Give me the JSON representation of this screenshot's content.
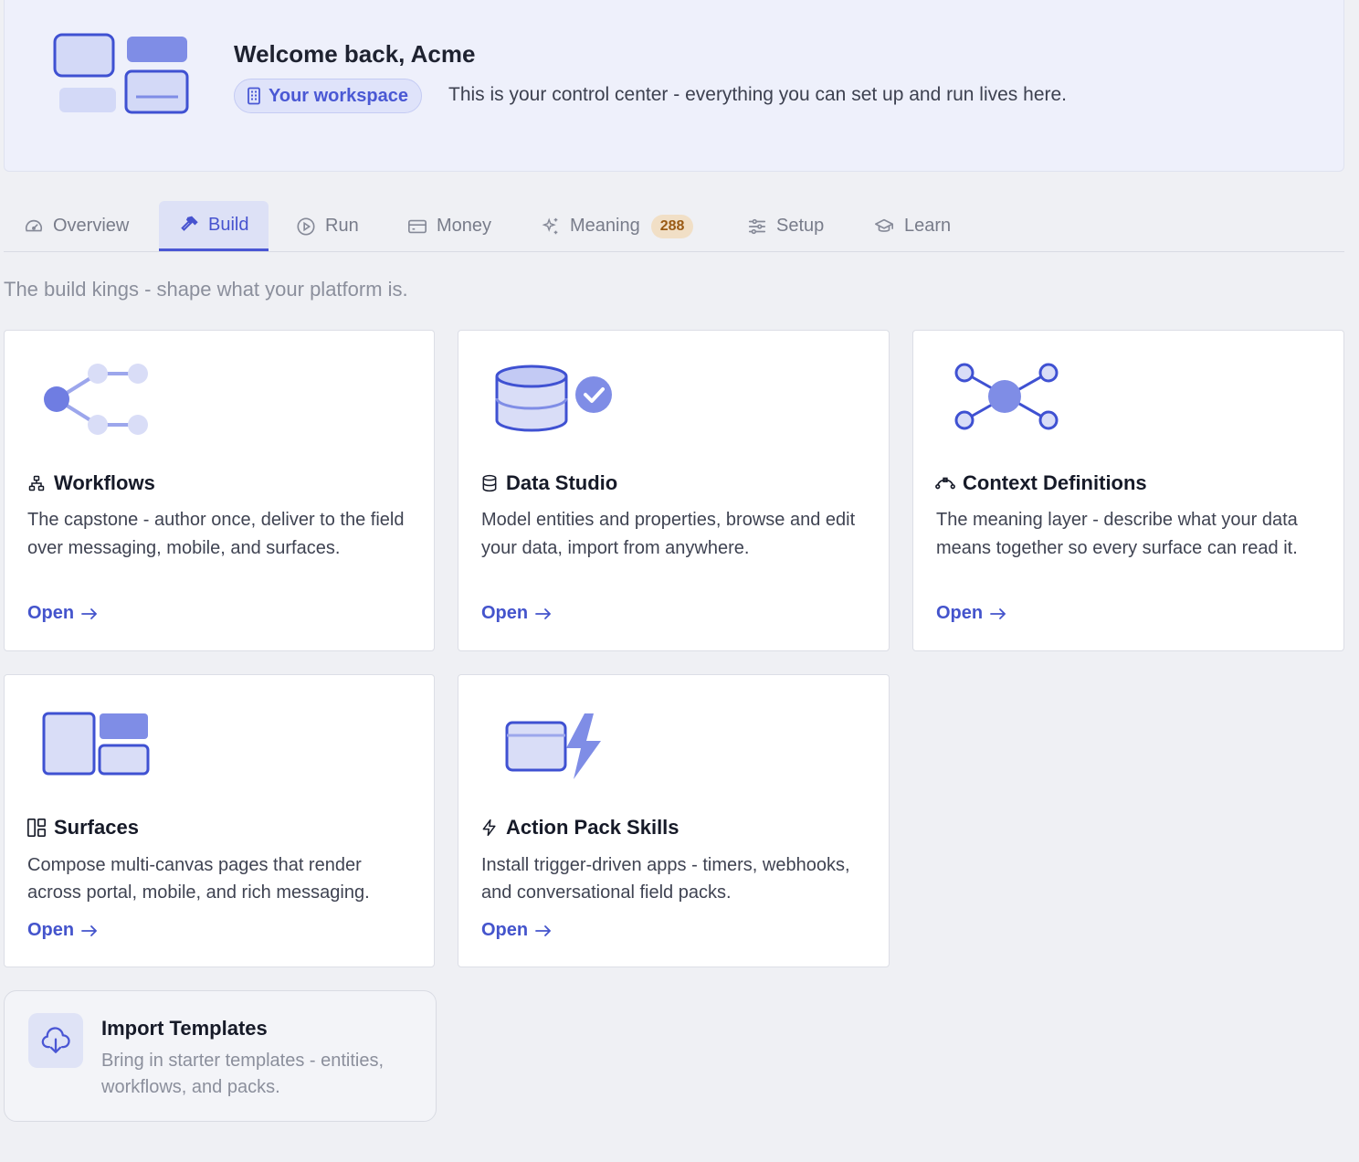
{
  "hero": {
    "title": "Welcome back, Acme",
    "workspace_pill": "Your workspace",
    "subtitle": "This is your control center - everything you can set up and run lives here."
  },
  "tabs": [
    {
      "label": "Overview",
      "icon": "gauge-icon",
      "active": false
    },
    {
      "label": "Build",
      "icon": "hammer-icon",
      "active": true
    },
    {
      "label": "Run",
      "icon": "play-circle-icon",
      "active": false
    },
    {
      "label": "Money",
      "icon": "credit-card-icon",
      "active": false
    },
    {
      "label": "Meaning",
      "icon": "sparkles-icon",
      "active": false,
      "badge": "288"
    },
    {
      "label": "Setup",
      "icon": "sliders-icon",
      "active": false
    },
    {
      "label": "Learn",
      "icon": "graduation-cap-icon",
      "active": false
    }
  ],
  "lede": "The build kings - shape what your platform is.",
  "cards": [
    {
      "title": "Workflows",
      "icon": "workflow-icon",
      "description": "The capstone - author once, deliver to the field over messaging, mobile, and surfaces.",
      "link": "Open"
    },
    {
      "title": "Data Studio",
      "icon": "database-icon",
      "description": "Model entities and properties, browse and edit your data, import from anywhere.",
      "link": "Open"
    },
    {
      "title": "Context Definitions",
      "icon": "spline-icon",
      "description": "The meaning layer - describe what your data means together so every surface can read it.",
      "link": "Open"
    },
    {
      "title": "Surfaces",
      "icon": "layout-panels-icon",
      "description": "Compose multi-canvas pages that render across portal, mobile, and rich messaging.",
      "link": "Open"
    },
    {
      "title": "Action Pack Skills",
      "icon": "zap-icon",
      "description": "Install trigger-driven apps - timers, webhooks, and conversational field packs.",
      "link": "Open"
    }
  ],
  "import": {
    "title": "Import Templates",
    "description": "Bring in starter templates - entities, workflows, and packs.",
    "icon": "cloud-download-icon"
  },
  "colors": {
    "accent": "#4a56d4",
    "accent_soft": "#dde1f6",
    "badge_bg": "#f1dfc6",
    "badge_text": "#9a5a14",
    "page_bg": "#eff0f4"
  }
}
